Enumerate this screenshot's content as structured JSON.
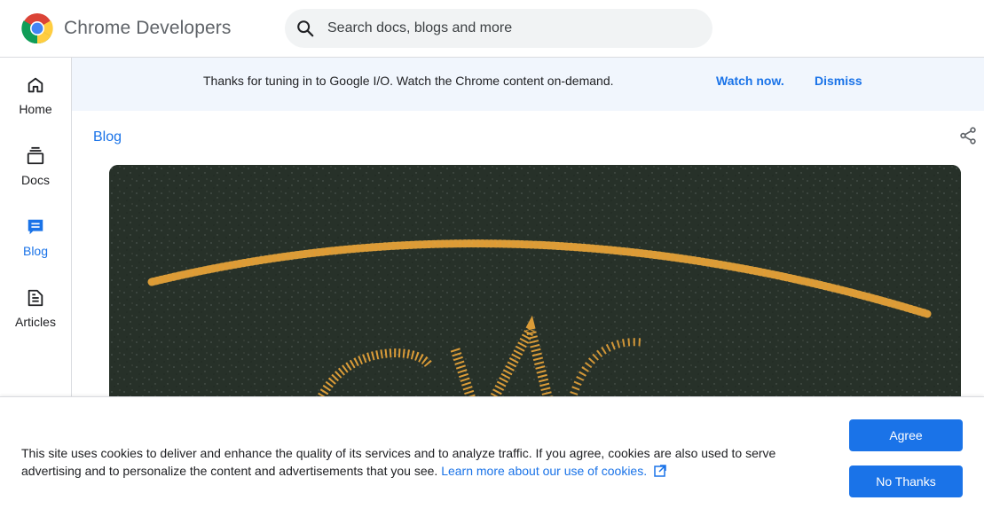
{
  "header": {
    "brand": "Chrome Developers",
    "search": {
      "placeholder": "Search docs, blogs and more",
      "icon": "search-icon"
    }
  },
  "rail": {
    "items": [
      {
        "label": "Home",
        "icon": "home-icon",
        "active": false
      },
      {
        "label": "Docs",
        "icon": "docs-icon",
        "active": false
      },
      {
        "label": "Blog",
        "icon": "blog-icon",
        "active": true
      },
      {
        "label": "Articles",
        "icon": "articles-icon",
        "active": false
      }
    ]
  },
  "banner": {
    "message": "Thanks for tuning in to Google I/O. Watch the Chrome content on-demand.",
    "watch_label": "Watch now.",
    "dismiss_label": "Dismiss"
  },
  "page": {
    "breadcrumb": "Blog",
    "share_icon": "share-icon"
  },
  "cookie": {
    "text": "This site uses cookies to deliver and enhance the quality of its services and to analyze traffic. If you agree, cookies are also used to serve advertising and to personalize the content and advertisements that you see.",
    "link": "Learn more about our use of cookies.",
    "agree_label": "Agree",
    "no_thanks_label": "No Thanks"
  },
  "colors": {
    "accent": "#1a73e8",
    "banner_bg": "#f1f6fd",
    "hero_bg": "#263029",
    "chalk": "#f0a83a"
  }
}
